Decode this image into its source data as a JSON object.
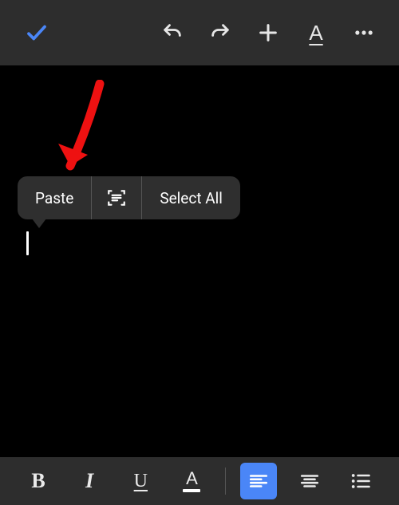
{
  "top_toolbar": {
    "confirm_icon": "checkmark-icon",
    "undo_icon": "undo-icon",
    "redo_icon": "redo-icon",
    "add_icon": "plus-icon",
    "text_style_icon": "text-style-icon",
    "text_style_glyph": "A",
    "overflow_icon": "more-icon"
  },
  "context_menu": {
    "paste_label": "Paste",
    "scan_icon": "scan-text-icon",
    "select_all_label": "Select All"
  },
  "annotation": {
    "arrow_color": "#e11"
  },
  "bottom_toolbar": {
    "bold_glyph": "B",
    "italic_glyph": "I",
    "underline_glyph": "U",
    "text_color_glyph": "A",
    "text_color_bar": "#ffffff",
    "align_left_icon": "align-left-icon",
    "align_center_icon": "align-center-icon",
    "bullet_list_icon": "bullet-list-icon",
    "selected": "align-left"
  }
}
